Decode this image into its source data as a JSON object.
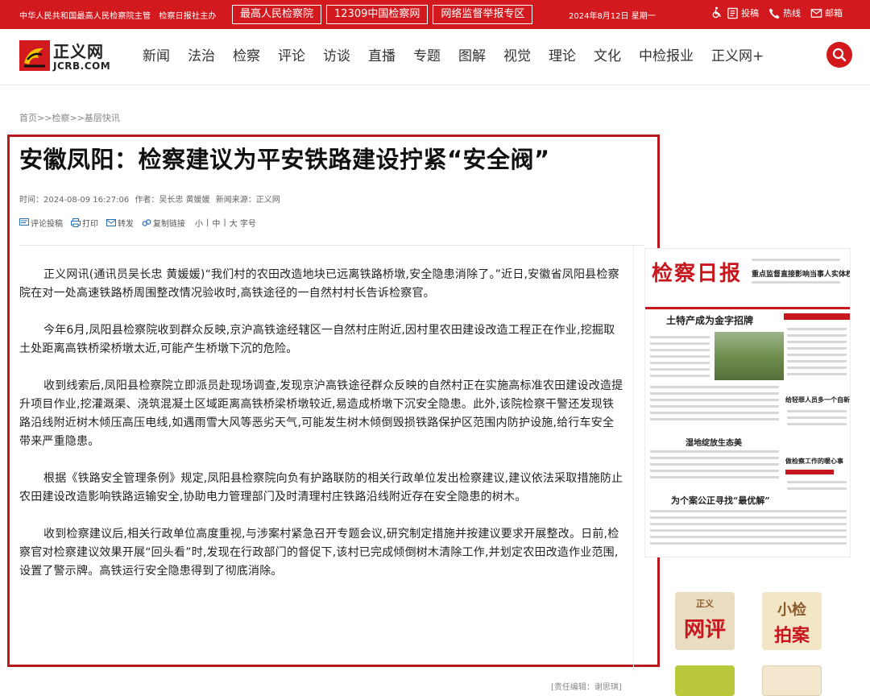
{
  "topbar": {
    "sponsor1": "中华人民共和国最高人民检察院主管",
    "sponsor2": "检察日报社主办",
    "links": [
      "最高人民检察院",
      "12309中国检察网",
      "网络监督举报专区"
    ],
    "date": "2024年8月12日 星期一",
    "utils": {
      "submit": "投稿",
      "hotline": "热线",
      "mail": "邮箱"
    }
  },
  "header": {
    "logo_cn": "正义网",
    "logo_en": "JCRB.COM",
    "nav": [
      "新闻",
      "法治",
      "检察",
      "评论",
      "访谈",
      "直播",
      "专题",
      "图解",
      "视觉",
      "理论",
      "文化",
      "中检报业",
      "正义网+"
    ]
  },
  "breadcrumb": [
    "首页",
    ">>",
    "检察",
    ">>",
    "基层快讯"
  ],
  "article": {
    "title": "安徽凤阳：检察建议为平安铁路建设拧紧“安全阀”",
    "time_label": "时间：",
    "time": "2024-08-09 16:27:06",
    "author_label": "作者：",
    "author": "吴长忠 黄媛媛",
    "source_label": "新闻来源：",
    "source": "正义网",
    "tools": {
      "comment": "评论投稿",
      "print": "打印",
      "forward": "转发",
      "copy": "复制链接",
      "small": "小",
      "sep": "|",
      "medium": "中",
      "large": "大 字号"
    },
    "paragraphs": [
      "正义网讯(通讯员吴长忠 黄媛媛)“我们村的农田改造地块已远离铁路桥墩,安全隐患消除了。”近日,安徽省凤阳县检察院在对一处高速铁路桥周围整改情况验收时,高铁途径的一自然村村长告诉检察官。",
      "今年6月,凤阳县检察院收到群众反映,京沪高铁途经辖区一自然村庄附近,因村里农田建设改造工程正在作业,挖掘取土处距离高铁桥梁桥墩太近,可能产生桥墩下沉的危险。",
      "收到线索后,凤阳县检察院立即派员赴现场调查,发现京沪高铁途径群众反映的自然村正在实施高标准农田建设改造提升项目作业,挖灌溉渠、浇筑混凝土区域距离高铁桥梁桥墩较近,易造成桥墩下沉安全隐患。此外,该院检察干警还发现铁路沿线附近树木倾压高压电线,如遇雨雪大风等恶劣天气,可能发生树木倾倒毁损铁路保护区范围内防护设施,给行车安全带来严重隐患。",
      "根据《铁路安全管理条例》规定,凤阳县检察院向负有护路联防的相关行政单位发出检察建议,建议依法采取措施防止农田建设改造影响铁路运输安全,协助电力管理部门及时清理村庄铁路沿线附近存在安全隐患的树木。",
      "收到检察建议后,相关行政单位高度重视,与涉案村紧急召开专题会议,研究制定措施并按建议要求开展整改。日前,检察官对检察建议效果开展“回头看”时,发现在行政部门的督促下,该村已完成倾倒树木清除工作,并划定农田改造作业范围,设置了警示牌。高铁运行安全隐患得到了彻底消除。"
    ],
    "editor": "[责任编辑：谢思琪]"
  },
  "sidebar": {
    "paper": {
      "masthead": "检察日报",
      "top_headline": "重点监督直接影响当事人实体权益的案件",
      "headline1": "土特产成为金字招牌",
      "headline2": "湿地绽放生态美",
      "headline3": "为个案公正寻找“最优解”",
      "side1": "给轻罪人员多一个自新机会",
      "side2": "做检察工作的暖心事"
    },
    "promos": [
      {
        "top": "正义",
        "main": "网评"
      },
      {
        "top": "小检",
        "main": "拍案"
      }
    ]
  },
  "colors": {
    "brand_red": "#d2191e",
    "frame_red": "#b8191d"
  }
}
